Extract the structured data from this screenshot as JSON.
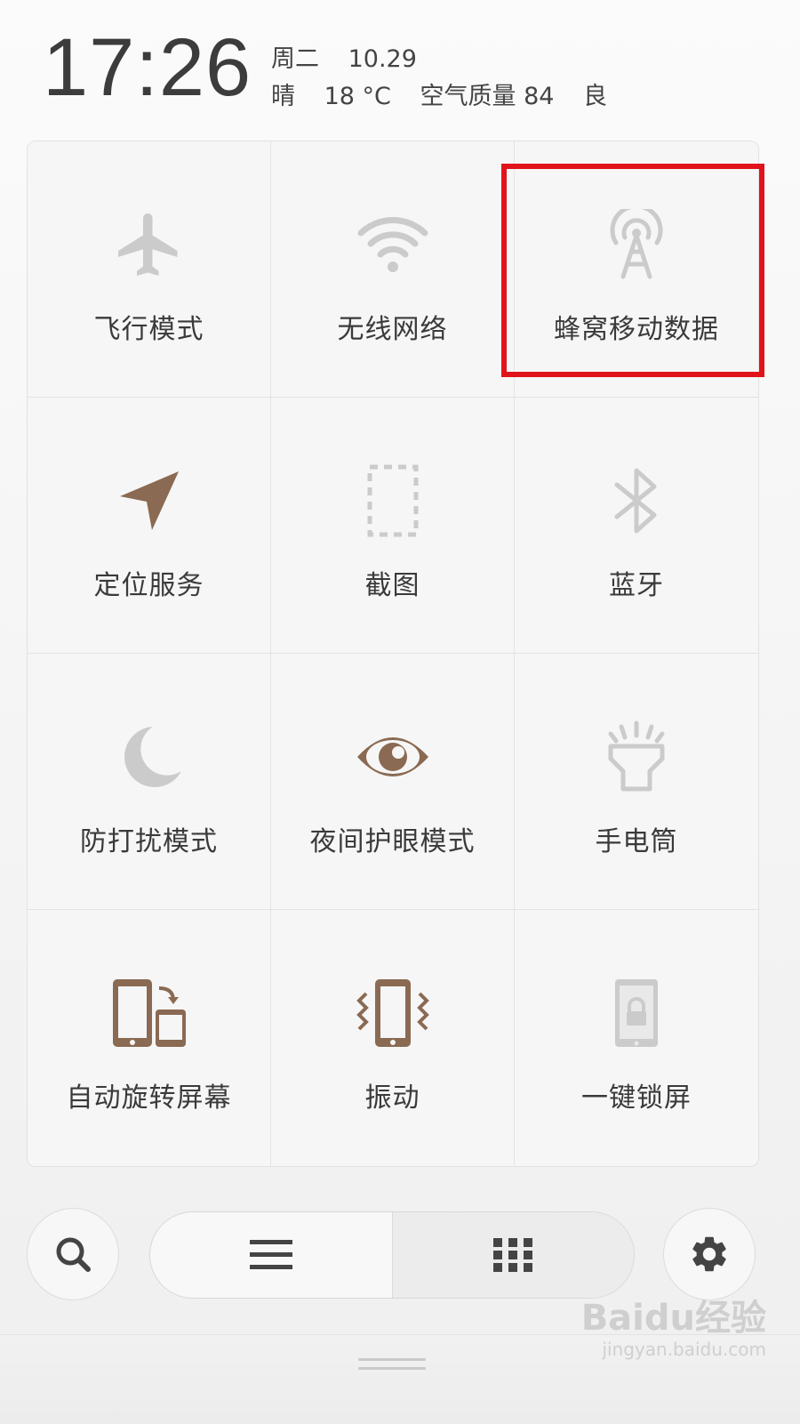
{
  "status": {
    "time": "17:26",
    "weekday": "周二",
    "date": "10.29",
    "weather": "晴",
    "temperature": "18 °C",
    "air_quality": "空气质量 84",
    "air_level": "良"
  },
  "tiles": [
    {
      "label": "飞行模式",
      "icon": "airplane-icon"
    },
    {
      "label": "无线网络",
      "icon": "wifi-icon"
    },
    {
      "label": "蜂窝移动数据",
      "icon": "cellular-antenna-icon"
    },
    {
      "label": "定位服务",
      "icon": "location-arrow-icon"
    },
    {
      "label": "截图",
      "icon": "screenshot-icon"
    },
    {
      "label": "蓝牙",
      "icon": "bluetooth-icon"
    },
    {
      "label": "防打扰模式",
      "icon": "moon-icon"
    },
    {
      "label": "夜间护眼模式",
      "icon": "eye-icon"
    },
    {
      "label": "手电筒",
      "icon": "flashlight-icon"
    },
    {
      "label": "自动旋转屏幕",
      "icon": "auto-rotate-icon"
    },
    {
      "label": "振动",
      "icon": "vibrate-icon"
    },
    {
      "label": "一键锁屏",
      "icon": "lock-screen-icon"
    }
  ],
  "highlight_tile": "蜂窝移动数据",
  "colors": {
    "active_icon": "#8a6a52",
    "inactive_icon": "#c9c9c9",
    "highlight_border": "#e0131b"
  },
  "bottom": {
    "search_icon": "search-icon",
    "list_icon": "list-icon",
    "grid_icon": "grid-icon",
    "settings_icon": "gear-icon"
  },
  "watermark": {
    "logo": "Baidu经验",
    "url": "jingyan.baidu.com"
  }
}
